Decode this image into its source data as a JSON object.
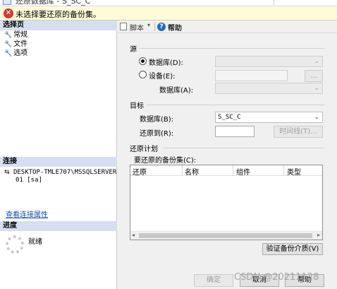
{
  "window": {
    "title": "还原数据库 - S_SC_C"
  },
  "banner": {
    "message": "未选择要还原的备份集。"
  },
  "left": {
    "select_page_header": "选择页",
    "pages": [
      {
        "label": "常规"
      },
      {
        "label": "文件"
      },
      {
        "label": "选项"
      }
    ],
    "connection_header": "连接",
    "connection_line1": "DESKTOP-TMLE707\\MSSQLSERVER",
    "connection_line2": "01 [sa]",
    "view_connection_link": "查看连接属性",
    "progress_header": "进度",
    "progress_status": "就绪"
  },
  "toolbar": {
    "script_label": "脚本",
    "help_label": "帮助"
  },
  "source": {
    "group_title": "源",
    "database_radio_label": "数据库(D):",
    "database_value": "",
    "device_radio_label": "设备(E):",
    "device_path": "",
    "browse_label": "...",
    "device_database_label": "数据库(A):",
    "device_database_value": ""
  },
  "target": {
    "group_title": "目标",
    "database_label": "数据库(B):",
    "database_value": "S_SC_C",
    "restore_to_label": "还原到(R):",
    "restore_to_value": "",
    "timeline_button": "时间线(T)..."
  },
  "plan": {
    "group_title": "还原计划",
    "backup_sets_label": "要还原的备份集(C):",
    "columns": [
      "还原",
      "名称",
      "组件",
      "类型"
    ],
    "rows": [],
    "verify_button": "验证备份介质(V)"
  },
  "footer": {
    "ok": "确定",
    "cancel": "取消",
    "help": "帮助"
  },
  "watermark": "CSDN @20211128"
}
